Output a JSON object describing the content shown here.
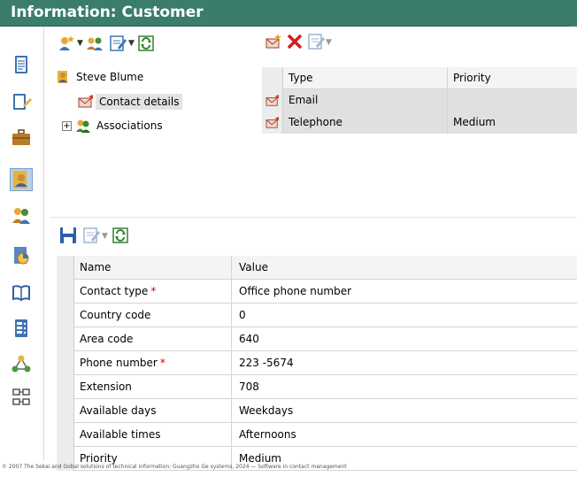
{
  "window": {
    "title": "Information: Customer"
  },
  "colors": {
    "titlebar": "#3a7d6b",
    "selected_row": "#e0e0e0",
    "required": "#d40000"
  },
  "sidebar": {
    "items": [
      {
        "icon": "document-icon"
      },
      {
        "icon": "edit-document-icon"
      },
      {
        "icon": "briefcase-icon"
      },
      {
        "icon": "contact-card-icon",
        "active": true
      },
      {
        "icon": "people-icon"
      },
      {
        "icon": "report-icon"
      },
      {
        "icon": "book-icon"
      },
      {
        "icon": "phone-list-icon"
      },
      {
        "icon": "network-icon"
      },
      {
        "icon": "hierarchy-icon"
      }
    ]
  },
  "tree": {
    "root": {
      "label": "Steve Blume",
      "icon": "contact-card-icon"
    },
    "children": [
      {
        "label": "Contact details",
        "icon": "envelope-icon",
        "selected": true
      },
      {
        "label": "Associations",
        "icon": "people-icon",
        "expander": "+"
      }
    ]
  },
  "contacts_grid": {
    "columns": [
      "Type",
      "Priority"
    ],
    "rows": [
      {
        "type": "Email",
        "priority": "",
        "selected": true
      },
      {
        "type": "Telephone",
        "priority": "Medium",
        "selected": true
      }
    ]
  },
  "details_grid": {
    "columns": [
      "Name",
      "Value"
    ],
    "rows": [
      {
        "name": "Contact type",
        "required": true,
        "value": "Office phone number"
      },
      {
        "name": "Country code",
        "required": false,
        "value": "0"
      },
      {
        "name": "Area code",
        "required": false,
        "value": "640"
      },
      {
        "name": "Phone number",
        "required": true,
        "value": "223 -5674"
      },
      {
        "name": "Extension",
        "required": false,
        "value": "708"
      },
      {
        "name": "Available days",
        "required": false,
        "value": "Weekdays"
      },
      {
        "name": "Available times",
        "required": false,
        "value": "Afternoons"
      },
      {
        "name": "Priority",
        "required": false,
        "value": "Medium"
      }
    ],
    "required_marker": "*"
  },
  "footer": {
    "text": "© 2007 The Sekai and Gobal solutions of technical information: Guangzho Ge systems, 2024 — Software in contact management"
  }
}
